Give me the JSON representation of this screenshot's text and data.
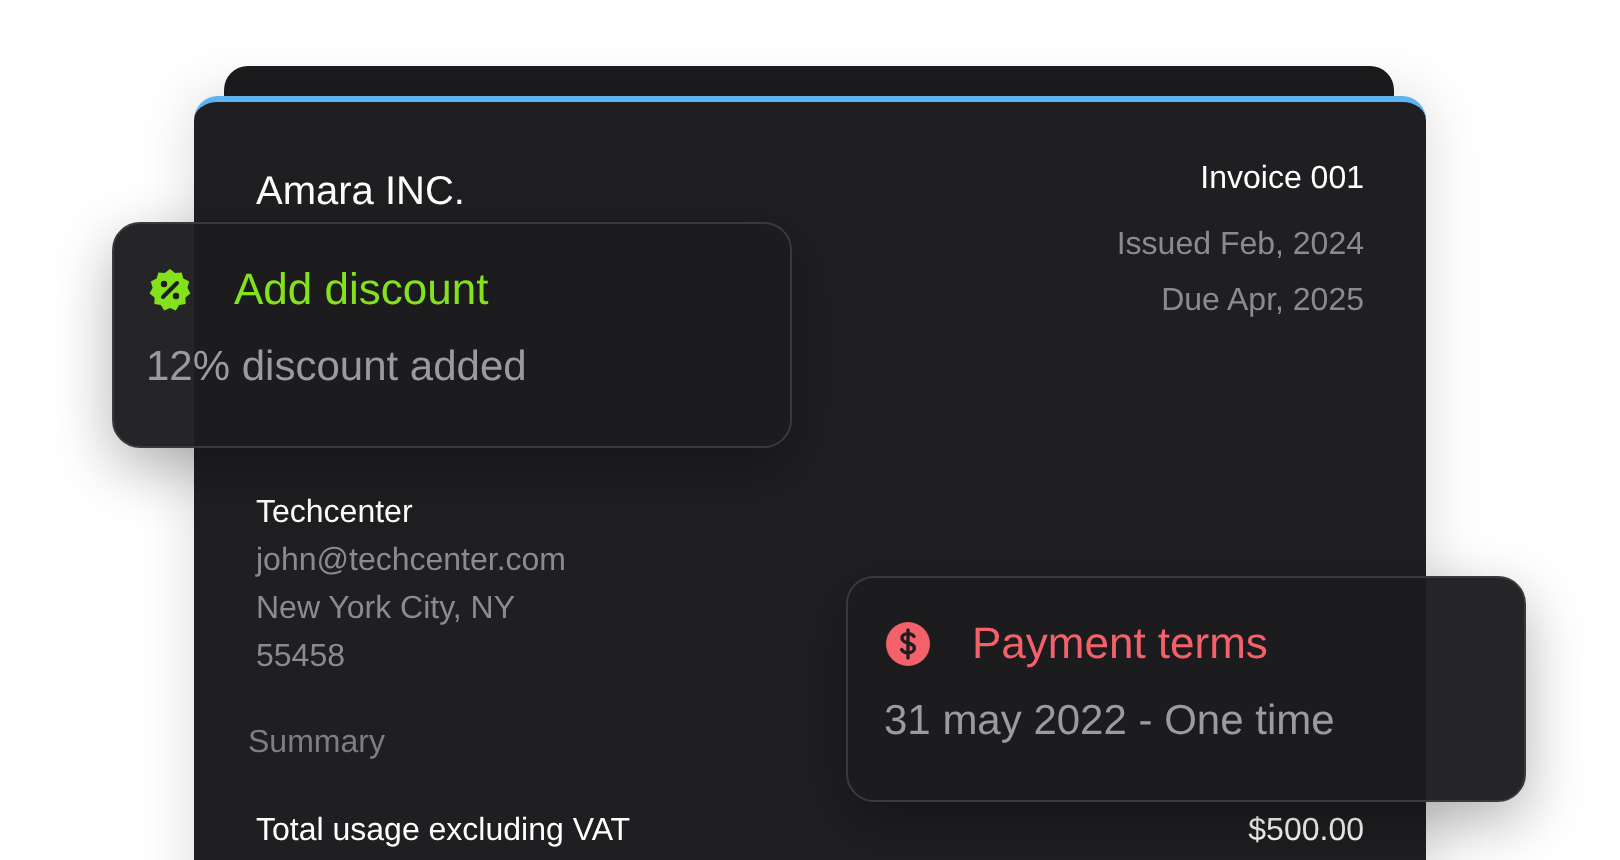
{
  "invoice": {
    "company": "Amara INC.",
    "number": "Invoice 001",
    "issued": "Issued Feb, 2024",
    "due": "Due Apr, 2025",
    "client": {
      "name": "Techcenter",
      "lines": [
        "john@techcenter.com",
        "New York City, NY",
        "55458"
      ]
    },
    "summary_label": "Summary",
    "rows": [
      {
        "label": "Total usage excluding VAT",
        "amount": "$500.00"
      }
    ]
  },
  "cards": [
    {
      "kind": "discount",
      "title": "Add discount",
      "text": "12% discount added",
      "color": "#84e21b"
    },
    {
      "kind": "payment",
      "title": "Payment terms",
      "text": "31 may 2022 - One time",
      "color": "#f4616a"
    }
  ]
}
